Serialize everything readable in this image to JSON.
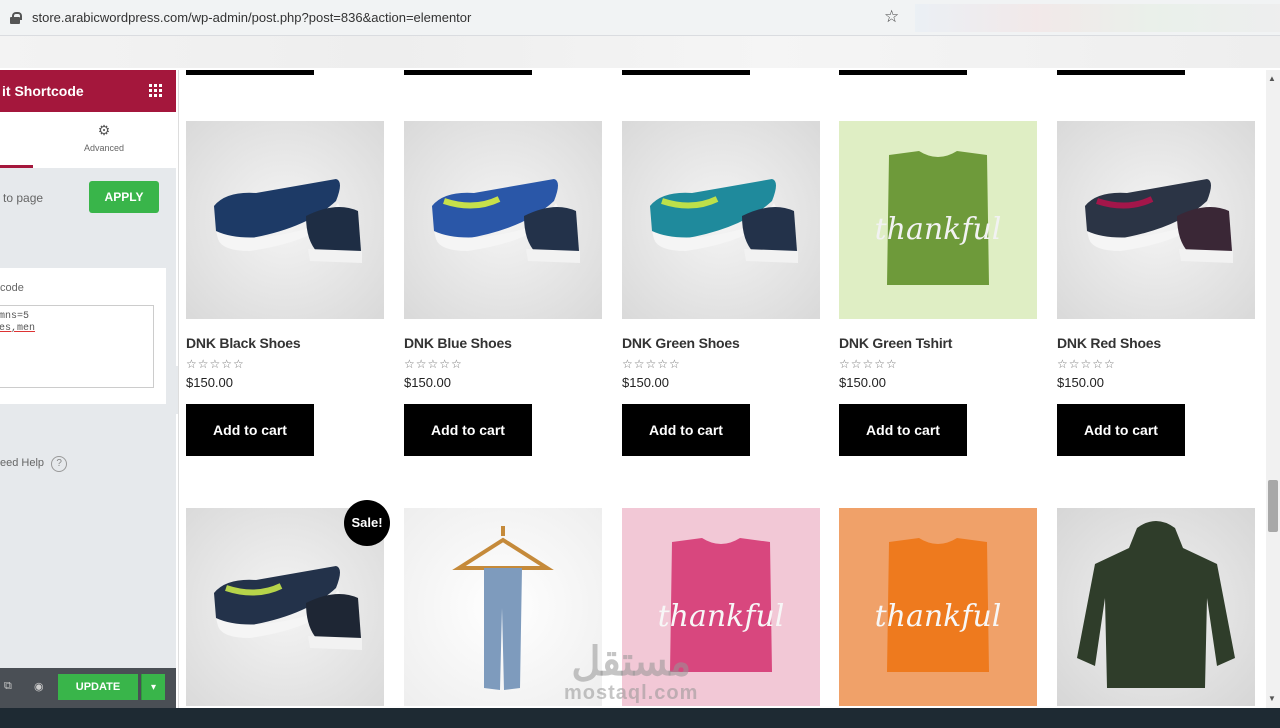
{
  "browser": {
    "url": "store.arabicwordpress.com/wp-admin/post.php?post=836&action=elementor"
  },
  "panel": {
    "title": "it Shortcode",
    "tab_advanced": "Advanced",
    "apply_text": "to page",
    "apply_button": "APPLY",
    "code_label": "code",
    "textarea_line1": "mns=5",
    "textarea_line2": "es,men",
    "help_text": "eed Help",
    "help_icon_glyph": "?",
    "update_button": "UPDATE",
    "update_caret": "▾"
  },
  "products": [
    {
      "name": "DNK Black Shoes",
      "price": "$150.00",
      "rating": "☆☆☆☆☆",
      "button": "Add to cart",
      "image": "shoe-icon"
    },
    {
      "name": "DNK Blue Shoes",
      "price": "$150.00",
      "rating": "☆☆☆☆☆",
      "button": "Add to cart",
      "image": "shoe-icon"
    },
    {
      "name": "DNK Green Shoes",
      "price": "$150.00",
      "rating": "☆☆☆☆☆",
      "button": "Add to cart",
      "image": "shoe-icon"
    },
    {
      "name": "DNK Green Tshirt",
      "price": "$150.00",
      "rating": "☆☆☆☆☆",
      "button": "Add to cart",
      "image": "tshirt-icon",
      "print": "thankful"
    },
    {
      "name": "DNK Red Shoes",
      "price": "$150.00",
      "rating": "☆☆☆☆☆",
      "button": "Add to cart",
      "image": "shoe-icon"
    }
  ],
  "products_row2": [
    {
      "image": "shoe-icon",
      "badge": "Sale!"
    },
    {
      "image": "jeans-hanger-icon"
    },
    {
      "image": "tshirt-icon",
      "print": "thankful"
    },
    {
      "image": "tshirt-icon",
      "print": "thankful"
    },
    {
      "image": "hoodie-icon"
    }
  ],
  "watermark": {
    "arabic": "مستقل",
    "latin": "mostaql.com"
  },
  "colors": {
    "elementor_header": "#a4173c",
    "apply_green": "#39b54a",
    "cart_button": "#000000"
  }
}
